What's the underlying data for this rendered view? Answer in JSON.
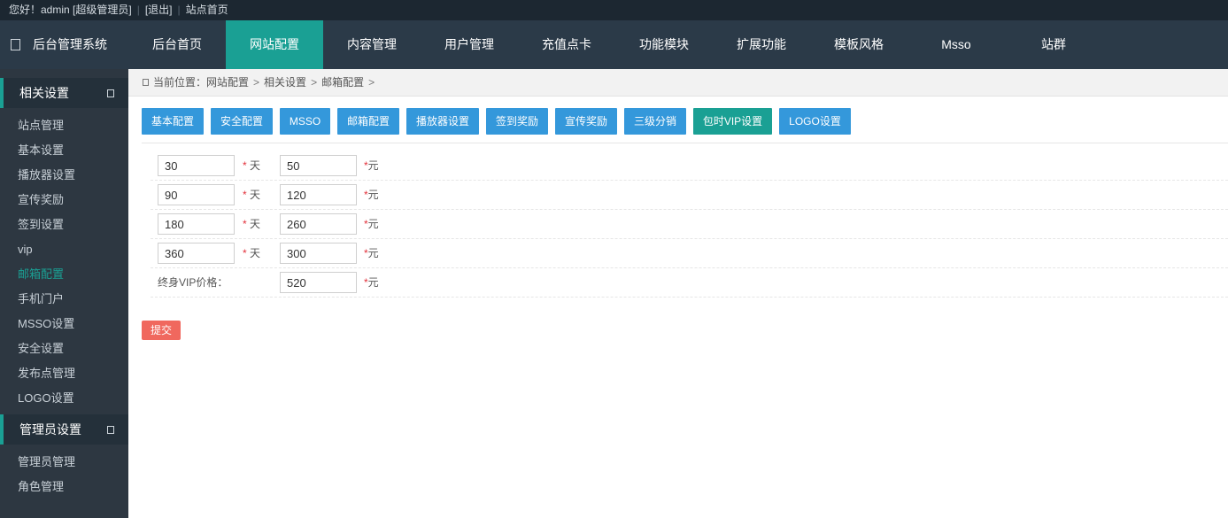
{
  "topbar": {
    "greeting": "您好！admin [超级管理员]",
    "logout": "[退出]",
    "site_home": "站点首页"
  },
  "header": {
    "brand": "后台管理系统",
    "nav": [
      {
        "label": "后台首页"
      },
      {
        "label": "网站配置",
        "active": true
      },
      {
        "label": "内容管理"
      },
      {
        "label": "用户管理"
      },
      {
        "label": "充值点卡"
      },
      {
        "label": "功能模块"
      },
      {
        "label": "扩展功能"
      },
      {
        "label": "模板风格"
      },
      {
        "label": "Msso"
      },
      {
        "label": "站群"
      }
    ]
  },
  "sidebar": {
    "group1": {
      "title": "相关设置",
      "items": [
        {
          "label": "站点管理"
        },
        {
          "label": "基本设置"
        },
        {
          "label": "播放器设置"
        },
        {
          "label": "宣传奖励"
        },
        {
          "label": "签到设置"
        },
        {
          "label": "vip"
        },
        {
          "label": "邮箱配置",
          "active": true
        },
        {
          "label": "手机门户"
        },
        {
          "label": "MSSO设置"
        },
        {
          "label": "安全设置"
        },
        {
          "label": "发布点管理"
        },
        {
          "label": "LOGO设置"
        }
      ]
    },
    "group2": {
      "title": "管理员设置",
      "items": [
        {
          "label": "管理员管理"
        },
        {
          "label": "角色管理"
        }
      ]
    }
  },
  "breadcrumb": {
    "prefix": "当前位置：",
    "path": [
      "网站配置",
      "相关设置",
      "邮箱配置"
    ],
    "separator": ">"
  },
  "tabs": [
    {
      "label": "基本配置"
    },
    {
      "label": "安全配置"
    },
    {
      "label": "MSSO"
    },
    {
      "label": "邮箱配置"
    },
    {
      "label": "播放器设置"
    },
    {
      "label": "签到奖励"
    },
    {
      "label": "宣传奖励"
    },
    {
      "label": "三级分销"
    },
    {
      "label": "包时VIP设置",
      "active": true
    },
    {
      "label": "LOGO设置"
    }
  ],
  "form": {
    "star": "*",
    "days_unit": "天",
    "price_unit": "元",
    "rows": [
      {
        "days": "30",
        "price": "50"
      },
      {
        "days": "90",
        "price": "120"
      },
      {
        "days": "180",
        "price": "260"
      },
      {
        "days": "360",
        "price": "300"
      }
    ],
    "lifetime_label": "终身VIP价格：",
    "lifetime_price": "520",
    "submit_label": "提交"
  },
  "colors": {
    "accent": "#1aa094",
    "tab_blue": "#3498db",
    "submit": "#f0685e",
    "header_bg": "#2b3a48",
    "sidebar_bg": "#2d3741"
  }
}
